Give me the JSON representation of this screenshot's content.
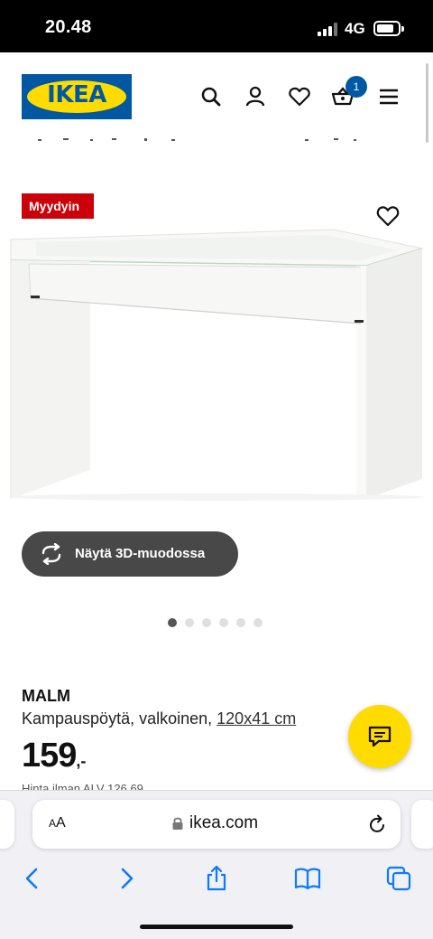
{
  "status_bar": {
    "time": "20.48",
    "network": "4G"
  },
  "header": {
    "logo_text": "IKEA",
    "cart_count": "1",
    "icons": [
      "search-icon",
      "profile-icon",
      "heart-icon",
      "cart-icon",
      "menu-icon"
    ]
  },
  "product": {
    "badge": "Myydyin",
    "view3d_label": "Näytä 3D-muodossa",
    "gallery_count": 6,
    "gallery_active_index": 0,
    "name": "MALM",
    "description": "Kampauspöytä, valkoinen,",
    "size_link": "120x41 cm",
    "price": "159",
    "price_suffix": ",-",
    "price_note": "Hinta ilman ALV 126,69"
  },
  "browser": {
    "aa_small": "A",
    "aa_large": "A",
    "url": "ikea.com",
    "toolbar_icons": [
      "back-icon",
      "forward-icon",
      "share-icon",
      "bookmarks-icon",
      "tabs-icon"
    ]
  },
  "colors": {
    "ikea_blue": "#0058a3",
    "ikea_yellow": "#ffdb00",
    "badge_red": "#cc0008",
    "safari_blue": "#0a7aff"
  }
}
